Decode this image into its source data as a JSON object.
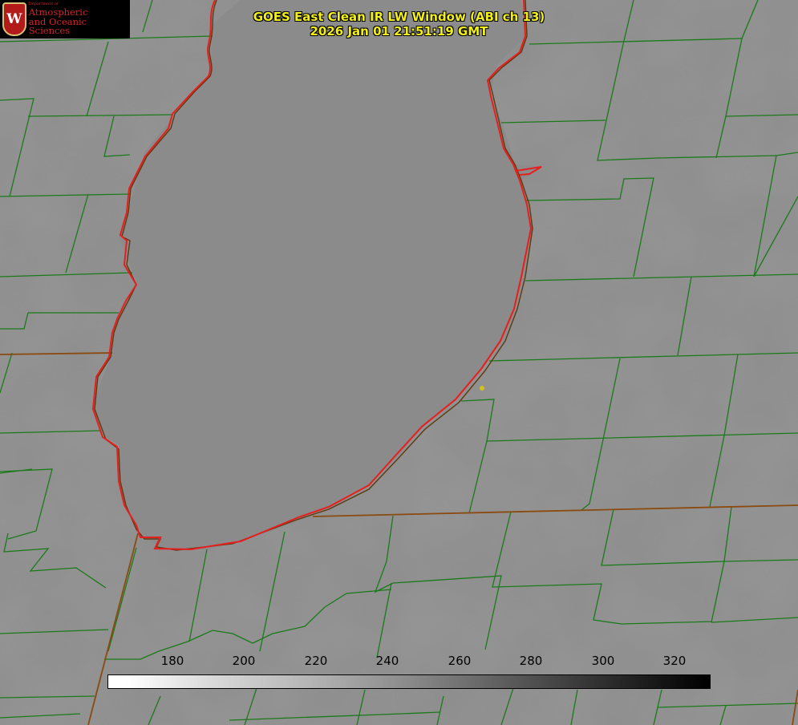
{
  "title": {
    "line1": "GOES East Clean IR LW Window (ABI ch 13)",
    "line2": "2026 Jan 01 21:51:19 GMT"
  },
  "logo": {
    "crest_letter": "W",
    "dept": "Department of",
    "line1": "Atmospheric",
    "line2": "and Oceanic Sciences"
  },
  "colorbar": {
    "ticks": [
      "180",
      "200",
      "220",
      "240",
      "260",
      "280",
      "300",
      "320"
    ],
    "colormap": "grayscale, white (cold) to black (warm)"
  },
  "map": {
    "background_color": "#8e8e8e",
    "county_border_color": "#1a7a1a",
    "state_border_color": "#8a4a10",
    "coastline_color": "#e81e1e",
    "station_marker_color": "#d4c21a"
  }
}
